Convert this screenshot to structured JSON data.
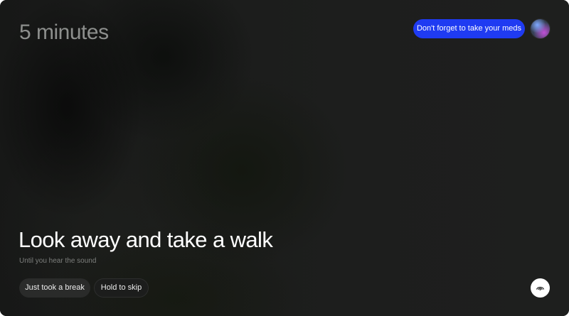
{
  "timer": {
    "text": "5 minutes"
  },
  "header": {
    "reminder_label": "Don't forget to take your meds"
  },
  "main": {
    "headline": "Look away and take a walk",
    "subline": "Until you hear the sound"
  },
  "actions": {
    "break_label": "Just took a break",
    "skip_label": "Hold to skip"
  },
  "icons": {
    "avatar": "user-avatar",
    "eye": "eye-icon"
  },
  "colors": {
    "accent": "#1f3bf2",
    "background": "#1c1d1c",
    "headline": "#ffffff",
    "muted": "#7d7f7d"
  }
}
